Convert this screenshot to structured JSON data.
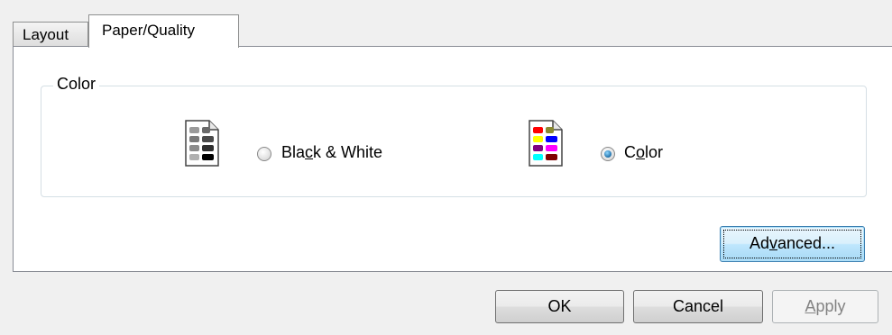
{
  "tabs": [
    {
      "label": "Layout",
      "active": false
    },
    {
      "label": "Paper/Quality",
      "active": true
    }
  ],
  "color_group": {
    "title": "Color",
    "options": [
      {
        "label_prefix": "Bla",
        "label_mnemonic": "c",
        "label_suffix": "k & White",
        "selected": false,
        "icon": "grayscale-document-icon"
      },
      {
        "label_prefix": "C",
        "label_mnemonic": "o",
        "label_suffix": "lor",
        "selected": true,
        "icon": "color-document-icon"
      }
    ]
  },
  "buttons": {
    "advanced": {
      "prefix": "Ad",
      "mnemonic": "v",
      "suffix": "anced..."
    },
    "ok": "OK",
    "cancel": "Cancel",
    "apply": {
      "mnemonic": "A",
      "suffix": "pply",
      "disabled": true
    }
  },
  "colors": {
    "accent_focus": "#3c7fb1",
    "panel_bg": "#ffffff",
    "dialog_bg": "#f0f0f0"
  }
}
